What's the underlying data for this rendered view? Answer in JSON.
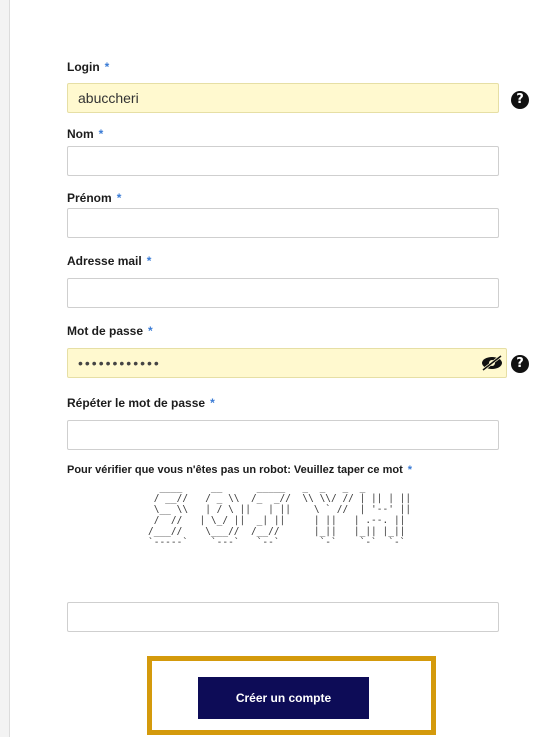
{
  "form": {
    "required_marker": "*",
    "login": {
      "label": "Login",
      "value": "abuccheri"
    },
    "nom": {
      "label": "Nom",
      "value": ""
    },
    "prenom": {
      "label": "Prénom",
      "value": ""
    },
    "email": {
      "label": "Adresse mail",
      "value": ""
    },
    "password": {
      "label": "Mot de passe",
      "masked_value": "••••••••••••"
    },
    "password_repeat": {
      "label": "Répéter le mot de passe",
      "value": ""
    },
    "captcha": {
      "label": "Pour vérifier que vous n'êtes pas un robot: Veuillez taper ce mot",
      "ascii_art": "  ____     __      _____   _  _   _  _\n / __//   / _ \\\\  /_  _//  \\\\ \\\\/ // | || | ||\n \\__ \\\\   | / \\ ||   | ||    \\ ` //  | '--' ||\n /  //   | \\_/ ||  _| ||     | ||   | .--. ||\n/___//    \\___//  /__//      |_||   |_|| |_||\n`-----`    `---`   `--`       `-`    `-`  `-`",
      "input_value": ""
    },
    "submit_label": "Créer un compte"
  },
  "icons": {
    "help": "question-circle-icon",
    "toggle_password": "eye-slash-icon"
  },
  "colors": {
    "required_marker": "#3a7bd5",
    "autofill_bg": "#fff9cf",
    "submit_bg": "#0d0c57",
    "highlight_border": "#d49a0c"
  }
}
